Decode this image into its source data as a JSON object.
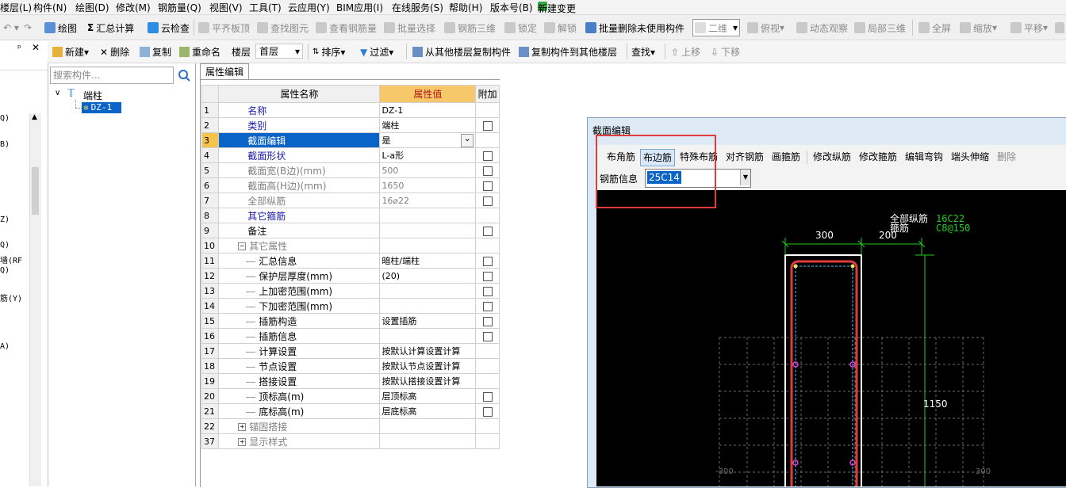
{
  "menubar": {
    "items": [
      "楼层(L)",
      "构件(N)",
      "绘图(D)",
      "修改(M)",
      "钢筋量(Q)",
      "视图(V)",
      "工具(T)",
      "云应用(Y)",
      "BIM应用(I)",
      "在线服务(S)",
      "帮助(H)",
      "版本号(B)",
      "新建变更"
    ]
  },
  "toolbar1": {
    "draw": "绘图",
    "summary": "汇总计算",
    "cloud_check": "云检查",
    "flatten": "平齐板顶",
    "find_drawing": "查找图元",
    "view_rebar": "查看钢筋量",
    "batch_select": "批量选择",
    "rebar3d": "钢筋三维",
    "lock": "锁定",
    "unlock": "解锁",
    "batch_delete": "批量删除未使用构件",
    "view_mode": "二维",
    "top_view": "俯视",
    "dynamic_view": "动态观察",
    "local3d": "局部三维",
    "fullscreen": "全屏",
    "zoom": "缩放",
    "pan": "平移"
  },
  "toolbar2": {
    "new": "新建",
    "delete": "删除",
    "copy": "复制",
    "rename": "重命名",
    "floor_label": "楼层",
    "floor_value": "首层",
    "sort": "排序",
    "filter": "过滤",
    "copy_from_floor": "从其他楼层复制构件",
    "copy_to_floor": "复制构件到其他楼层",
    "find": "查找",
    "move_up": "上移",
    "move_down": "下移"
  },
  "left_strip": {
    "items": [
      "Q)",
      "B)",
      "Z)",
      "Q)",
      "墙(RF",
      "Q)",
      "筋(Y)",
      "A)"
    ]
  },
  "tree": {
    "search_placeholder": "搜索构件...",
    "root": "端柱",
    "child": "DZ-1"
  },
  "prop": {
    "tab": "属性编辑",
    "headers": {
      "name": "属性名称",
      "value": "属性值",
      "extra": "附加"
    },
    "rows": [
      {
        "idx": "1",
        "name": "名称",
        "value": "DZ-1"
      },
      {
        "idx": "2",
        "name": "类别",
        "value": "端柱"
      },
      {
        "idx": "3",
        "name": "截面编辑",
        "value": "是"
      },
      {
        "idx": "4",
        "name": "截面形状",
        "value": "L-a形"
      },
      {
        "idx": "5",
        "name": "截面宽(B边)(mm)",
        "value": "500"
      },
      {
        "idx": "6",
        "name": "截面高(H边)(mm)",
        "value": "1650"
      },
      {
        "idx": "7",
        "name": "全部纵筋",
        "value": "16⌀22"
      },
      {
        "idx": "8",
        "name": "其它箍筋",
        "value": ""
      },
      {
        "idx": "9",
        "name": "备注",
        "value": ""
      },
      {
        "idx": "10",
        "name": "其它属性",
        "value": ""
      },
      {
        "idx": "11",
        "name": "汇总信息",
        "value": "暗柱/端柱"
      },
      {
        "idx": "12",
        "name": "保护层厚度(mm)",
        "value": "(20)"
      },
      {
        "idx": "13",
        "name": "上加密范围(mm)",
        "value": ""
      },
      {
        "idx": "14",
        "name": "下加密范围(mm)",
        "value": ""
      },
      {
        "idx": "15",
        "name": "插筋构造",
        "value": "设置插筋"
      },
      {
        "idx": "16",
        "name": "插筋信息",
        "value": ""
      },
      {
        "idx": "17",
        "name": "计算设置",
        "value": "按默认计算设置计算"
      },
      {
        "idx": "18",
        "name": "节点设置",
        "value": "按默认节点设置计算"
      },
      {
        "idx": "19",
        "name": "搭接设置",
        "value": "按默认搭接设置计算"
      },
      {
        "idx": "20",
        "name": "顶标高(m)",
        "value": "层顶标高"
      },
      {
        "idx": "21",
        "name": "底标高(m)",
        "value": "层底标高"
      },
      {
        "idx": "22",
        "name": "锚固搭接",
        "value": ""
      },
      {
        "idx": "37",
        "name": "显示样式",
        "value": ""
      }
    ]
  },
  "dialog": {
    "title": "截面编辑",
    "buttons": [
      "布角筋",
      "布边筋",
      "特殊布筋",
      "对齐钢筋",
      "画箍筋",
      "修改纵筋",
      "修改箍筋",
      "编辑弯钩",
      "端头伸缩",
      "删除"
    ],
    "rebar_label": "钢筋信息",
    "rebar_value": "25C14"
  },
  "canvas": {
    "label_all": "全部纵筋",
    "label_stirrup": "箍筋",
    "val_all": "16C22",
    "val_stirrup": "C8@150",
    "dim_300": "300",
    "dim_200": "200",
    "dim_1150": "1150",
    "grid_left": "-300",
    "grid_right": "300"
  },
  "colors": {
    "selection": "#0a64c8",
    "highlight": "#e23b3b",
    "dim_green": "#22cc22",
    "canvas_bg": "#000000"
  }
}
